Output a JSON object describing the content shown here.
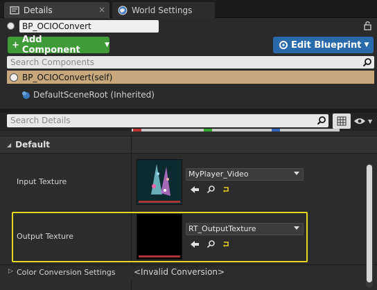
{
  "tabs": [
    {
      "label": "Details",
      "icon": "details-icon",
      "close": "×"
    },
    {
      "label": "World Settings",
      "icon": "globe-icon"
    }
  ],
  "blueprint": {
    "name": "BP_OCIOConvert"
  },
  "toolbar": {
    "add_component": "Add Component",
    "add_prefix": "+",
    "edit_blueprint": "Edit Blueprint"
  },
  "components": {
    "search_placeholder": "Search Components",
    "self_item": "BP_OCIOConvert(self)",
    "root_item": "DefaultSceneRoot (Inherited)"
  },
  "details": {
    "search_placeholder": "Search Details",
    "section": "Default",
    "properties": [
      {
        "label": "Input Texture",
        "value": "MyPlayer_Video"
      },
      {
        "label": "Output Texture",
        "value": "RT_OutputTexture"
      },
      {
        "label": "Color Conversion Settings",
        "value": "<Invalid Conversion>"
      }
    ]
  },
  "colors": {
    "add_button": "#3f9a38",
    "edit_button": "#2a6aaa",
    "selected_row": "#c8a77c",
    "highlight_border": "#e6d822"
  }
}
